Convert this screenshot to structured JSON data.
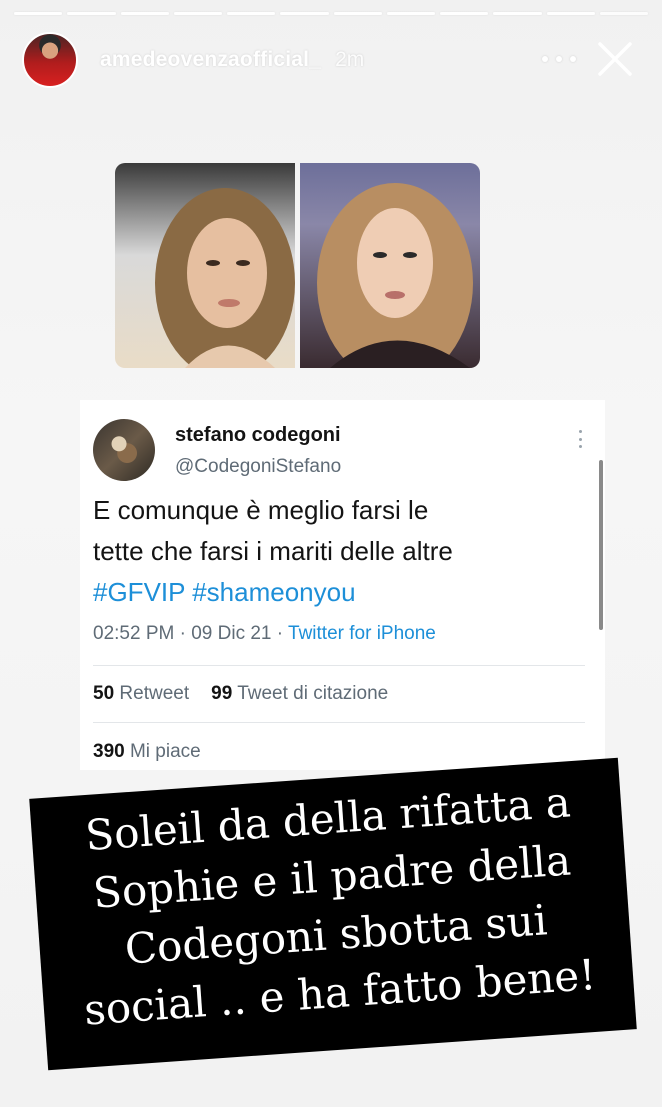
{
  "story": {
    "progress_segments": 12,
    "current_segment": 12
  },
  "header": {
    "username": "amedeovenzaofficial_",
    "time": "2m",
    "more_icon": "more-horizontal-icon",
    "close_icon": "close-icon"
  },
  "tweet": {
    "name": "stefano codegoni",
    "handle": "@CodegoniStefano",
    "text_line1": "E comunque è meglio farsi le",
    "text_line2": "tette che farsi i mariti delle altre",
    "hashtags": "#GFVIP #shameonyou",
    "time": "02:52 PM · 09 Dic 21 · ",
    "source": "Twitter for iPhone",
    "retweets_count": "50",
    "retweets_label": " Retweet",
    "quotes_count": "99",
    "quotes_label": " Tweet di citazione",
    "likes_count": "390",
    "likes_label": " Mi piace"
  },
  "caption": {
    "line1": "Soleil da della rifatta a",
    "line2": "Sophie e il padre della",
    "line3": "Codegoni sbotta sui",
    "line4": "social .. e ha fatto bene!"
  },
  "colors": {
    "accent": "#1d8fd8",
    "caption_bg": "#000000"
  }
}
